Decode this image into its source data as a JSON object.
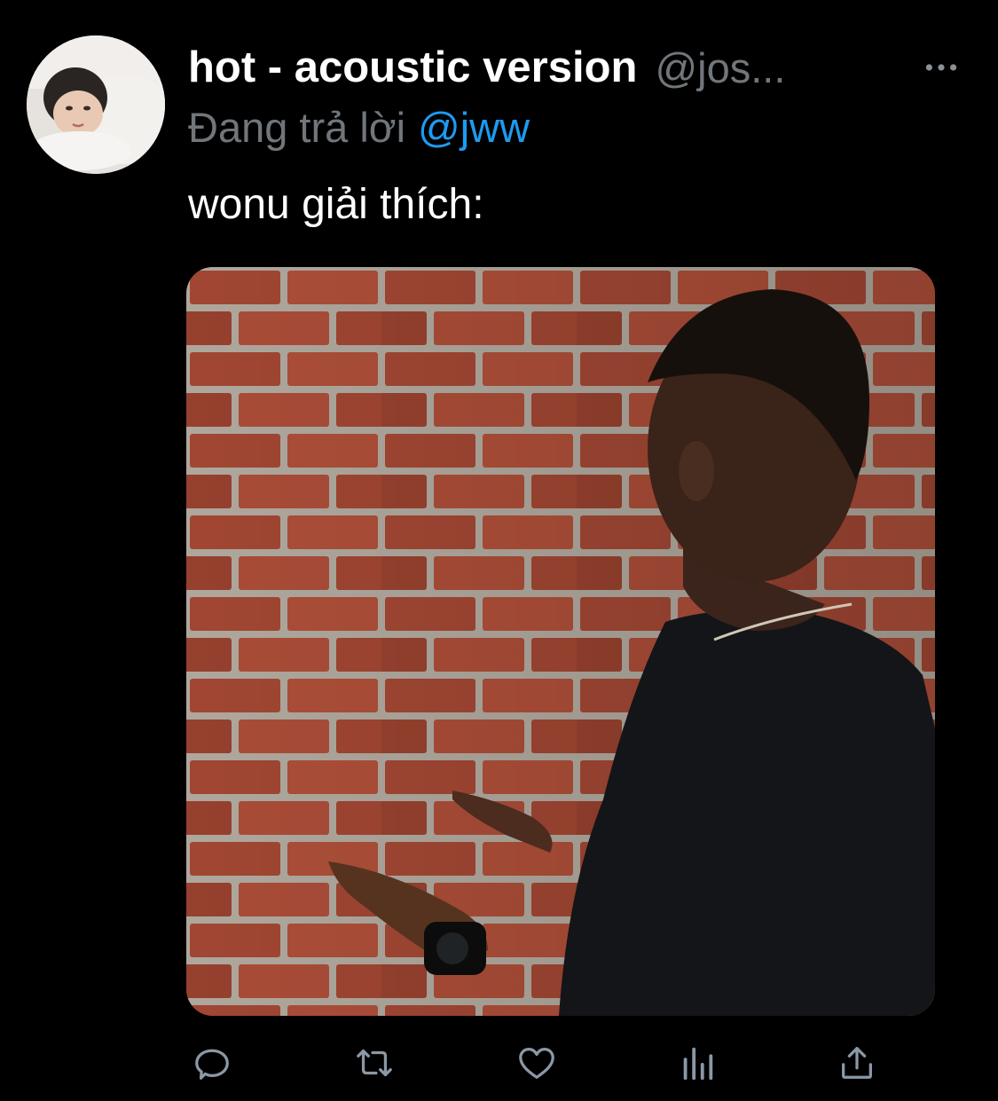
{
  "tweet": {
    "display_name": "hot - acoustic version",
    "handle": "@jos...",
    "reply_prefix": "Đang trả lời",
    "reply_mention": "@jww",
    "text": "wonu giải thích:"
  },
  "icons": {
    "more": "more-horizontal-icon",
    "reply": "reply-bubble-icon",
    "retweet": "retweet-icon",
    "like": "heart-icon",
    "analytics": "analytics-bars-icon",
    "share": "share-upload-icon"
  },
  "colors": {
    "background": "#000000",
    "primary_text": "#ffffff",
    "secondary_text": "#71767b",
    "link": "#1d9bf0"
  }
}
